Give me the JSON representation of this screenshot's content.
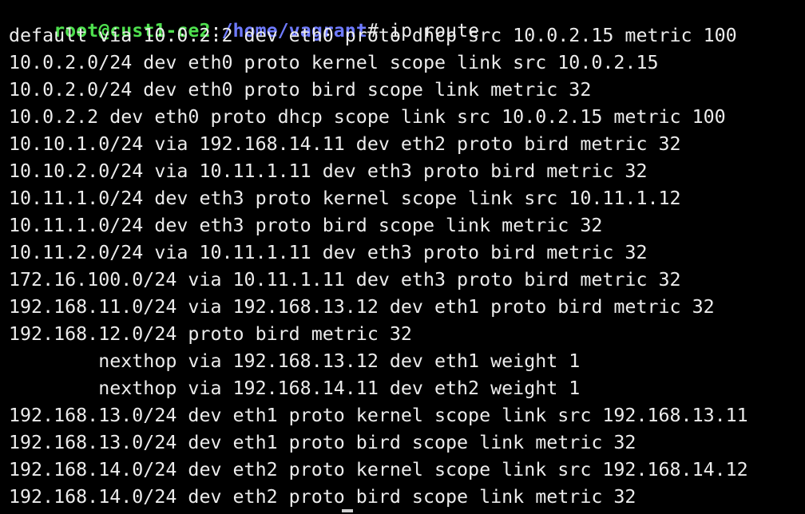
{
  "prompt": {
    "user_host": "root@cust1-ce2",
    "separator": ":",
    "path": "/home/vagrant",
    "symbol": "#",
    "command": " ip route"
  },
  "output_lines": [
    "default via 10.0.2.2 dev eth0 proto dhcp src 10.0.2.15 metric 100",
    "10.0.2.0/24 dev eth0 proto kernel scope link src 10.0.2.15",
    "10.0.2.0/24 dev eth0 proto bird scope link metric 32",
    "10.0.2.2 dev eth0 proto dhcp scope link src 10.0.2.15 metric 100",
    "10.10.1.0/24 via 192.168.14.11 dev eth2 proto bird metric 32",
    "10.10.2.0/24 via 10.11.1.11 dev eth3 proto bird metric 32",
    "10.11.1.0/24 dev eth3 proto kernel scope link src 10.11.1.12",
    "10.11.1.0/24 dev eth3 proto bird scope link metric 32",
    "10.11.2.0/24 via 10.11.1.11 dev eth3 proto bird metric 32",
    "172.16.100.0/24 via 10.11.1.11 dev eth3 proto bird metric 32",
    "192.168.11.0/24 via 192.168.13.12 dev eth1 proto bird metric 32",
    "192.168.12.0/24 proto bird metric 32",
    "        nexthop via 192.168.13.12 dev eth1 weight 1",
    "        nexthop via 192.168.14.11 dev eth2 weight 1",
    "192.168.13.0/24 dev eth1 proto kernel scope link src 192.168.13.11",
    "192.168.13.0/24 dev eth1 proto bird scope link metric 32",
    "192.168.14.0/24 dev eth2 proto kernel scope link src 192.168.14.12",
    "192.168.14.0/24 dev eth2 proto bird scope link metric 32"
  ],
  "colors": {
    "background": "#000000",
    "text": "#ececec",
    "user_host": "#4ee04e",
    "path": "#6f7bff"
  }
}
